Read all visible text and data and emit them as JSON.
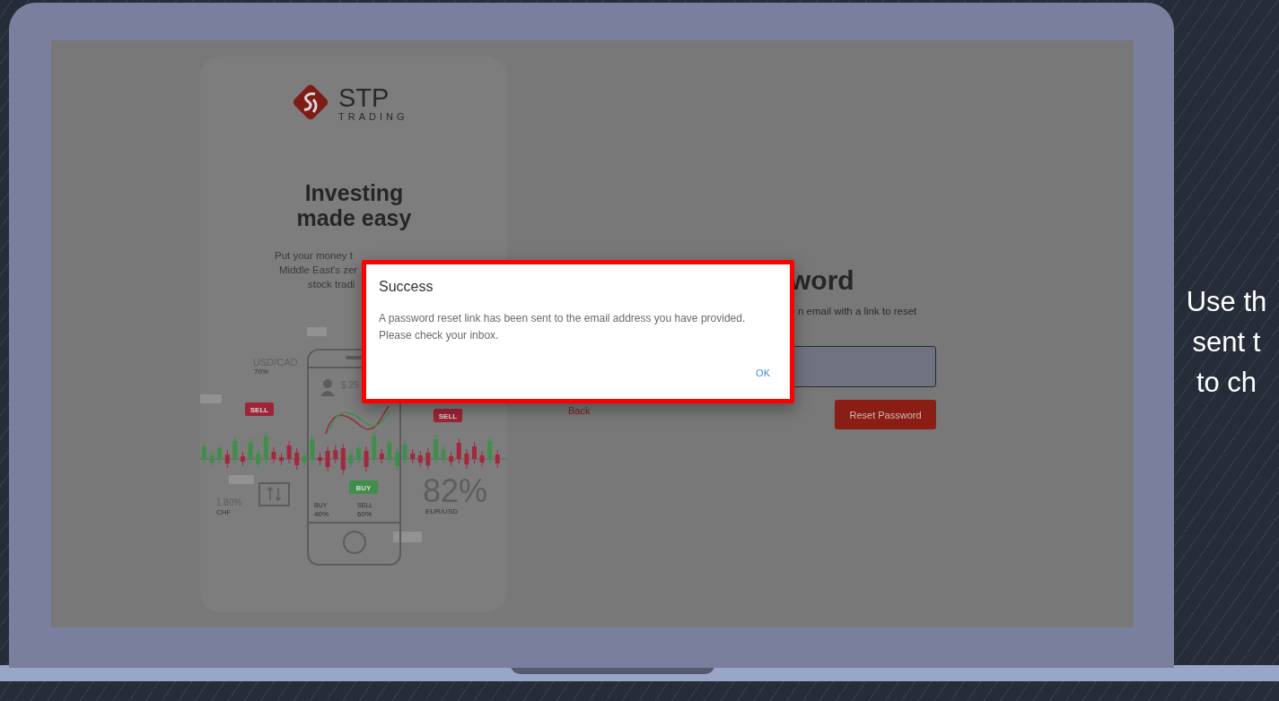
{
  "screen": {
    "promo_card": {
      "logo": {
        "name": "STP",
        "tagline": "TRADING"
      },
      "heading": [
        "Investing",
        "made easy"
      ],
      "text_lines": [
        "Put your money t",
        "Middle East's zer",
        "stock tradi"
      ],
      "illustration": {
        "pair_top": "USD/CAD",
        "pair_top_value": "70%",
        "sell_tags": [
          "SELL",
          "SELL"
        ],
        "buy_tag": "BUY",
        "balance": "$ 25",
        "buy_label": "BUY",
        "buy_share": "40%",
        "sell_label": "SELL",
        "sell_share": "60%",
        "rate": "1.80%",
        "currency": "CHF",
        "big_value": "82%",
        "big_pair": "EUR/USD"
      }
    },
    "form": {
      "heading_visible": "word",
      "subtitle_visible": "n email with a link to reset",
      "back_link": "Back",
      "submit_button": "Reset Password"
    },
    "dialog": {
      "title": "Success",
      "message": [
        "A password reset link has been sent to the email address you have provided.",
        "Please check your inbox."
      ],
      "button": "OK"
    }
  },
  "side_caption": [
    "Use th",
    "sent t",
    "to ch"
  ]
}
